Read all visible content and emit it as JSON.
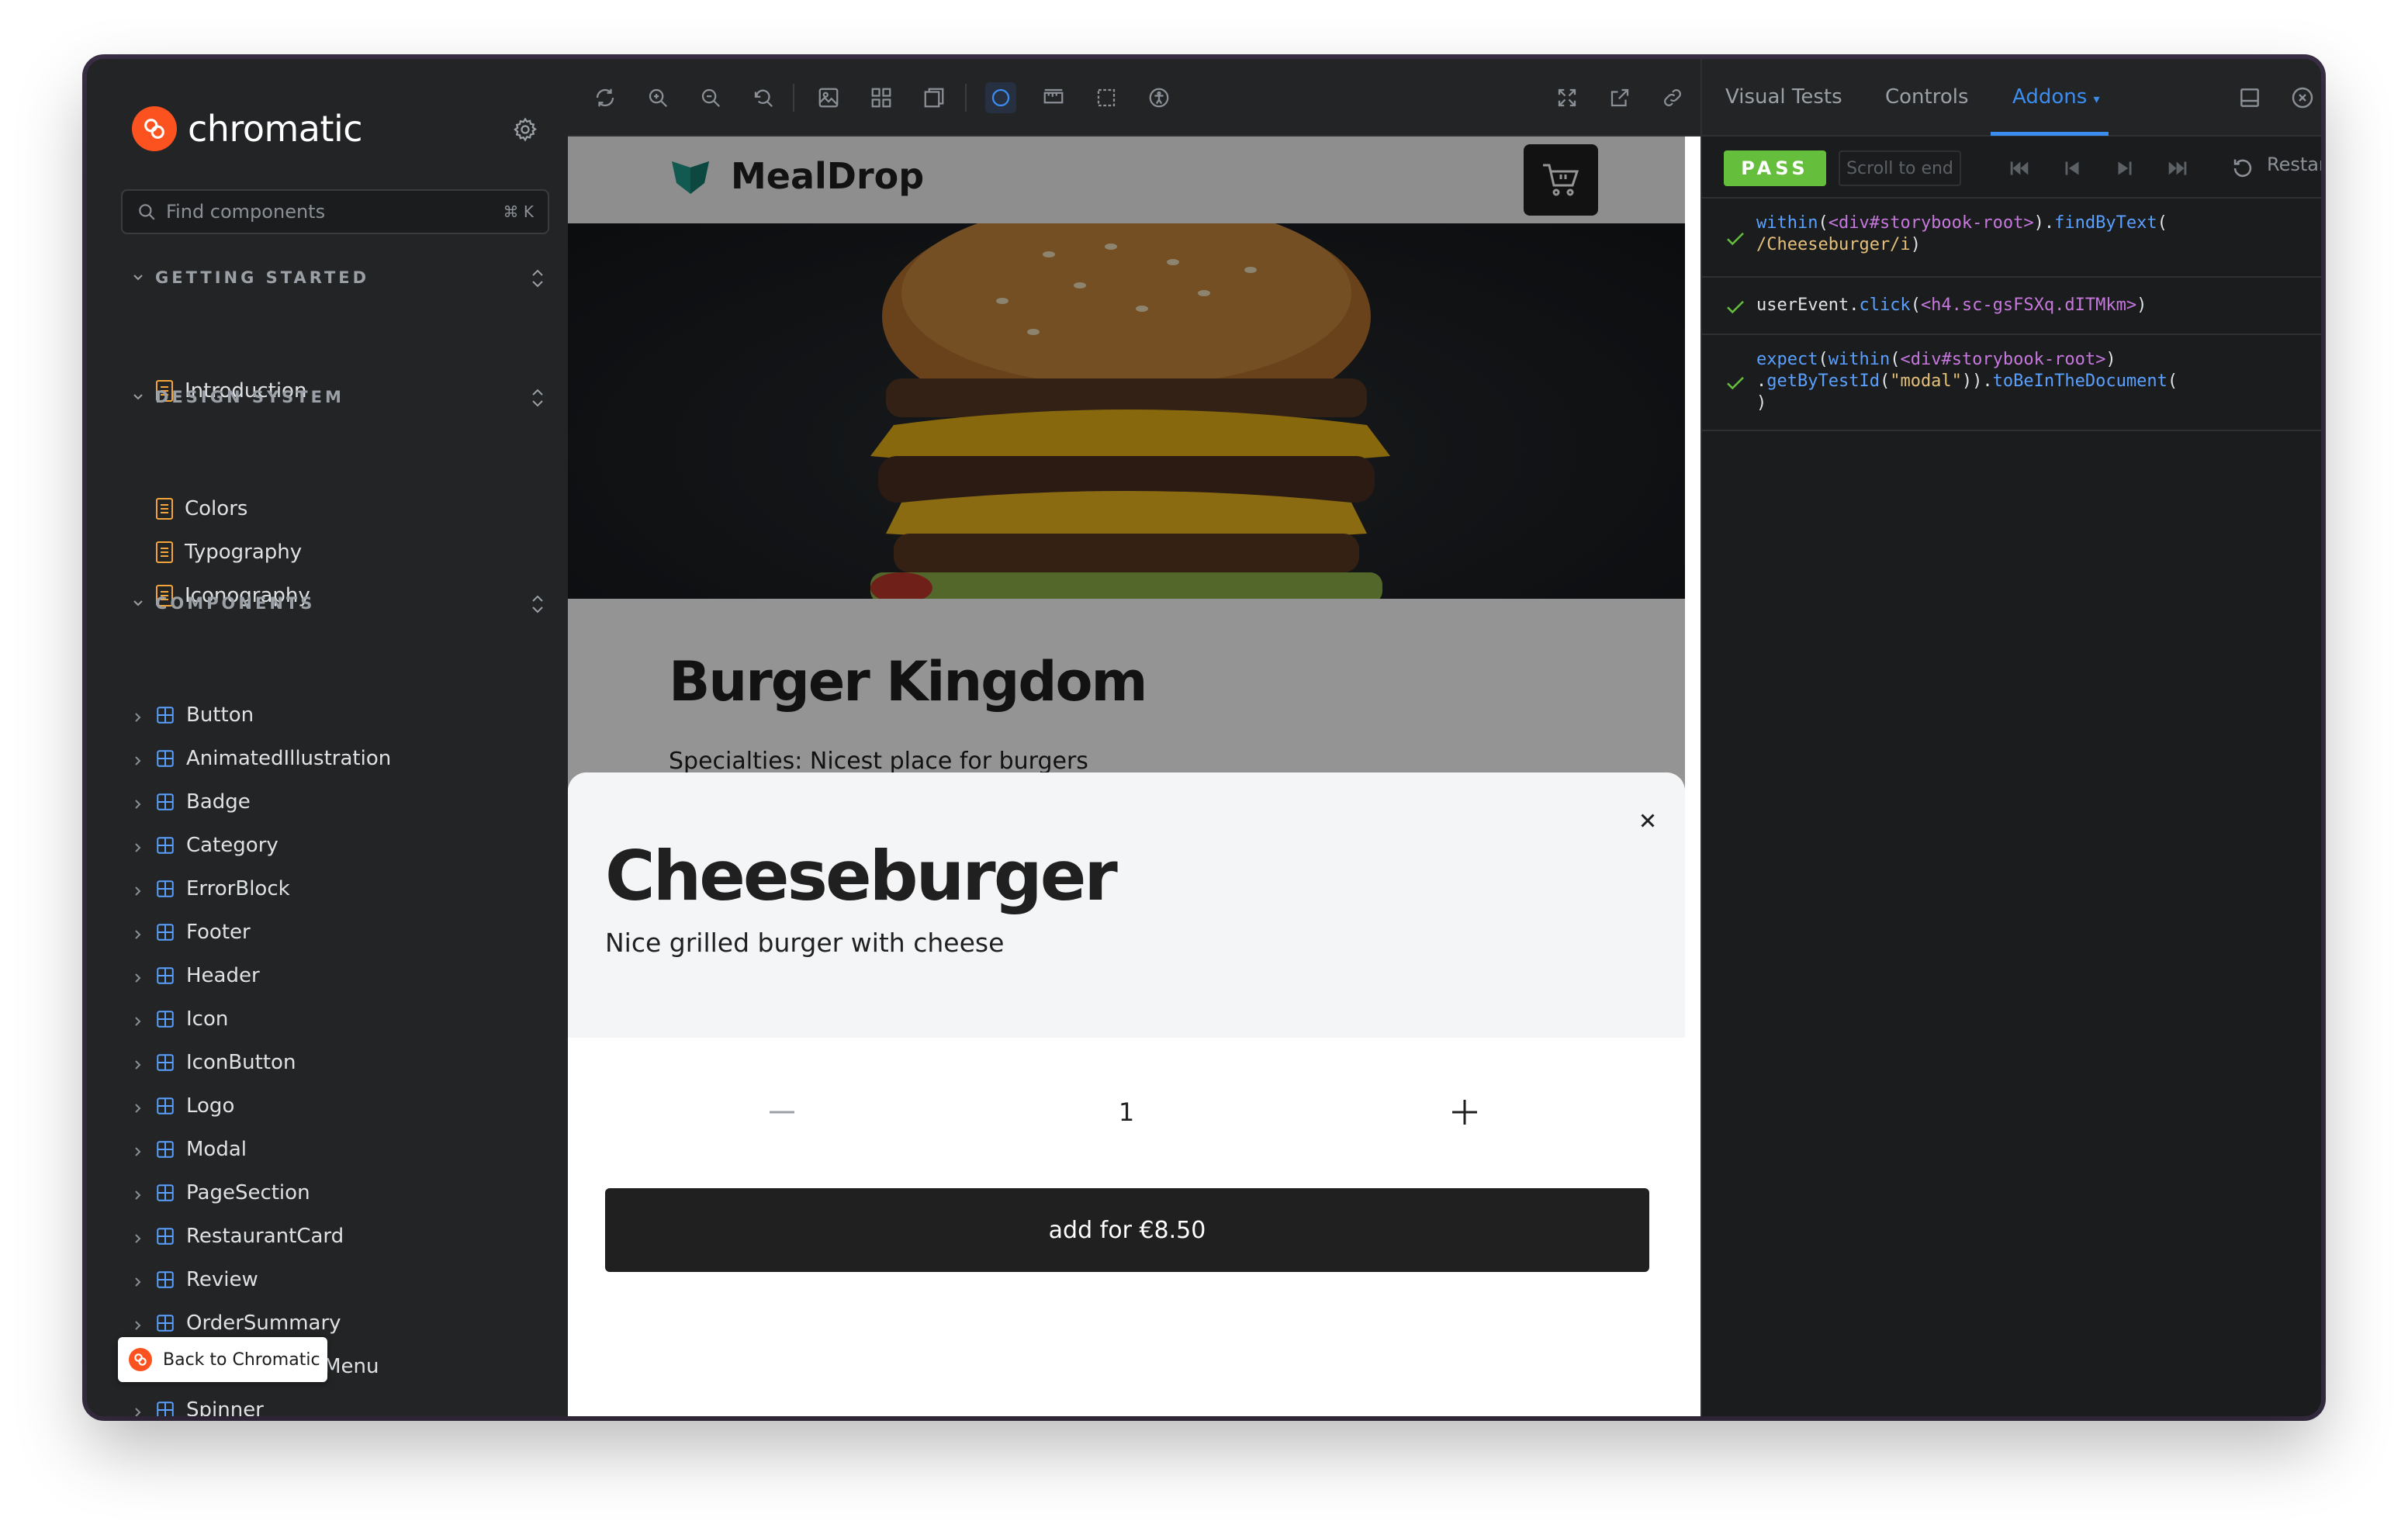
{
  "brand": {
    "name": "chromatic"
  },
  "sidebar": {
    "search_placeholder": "Find components",
    "search_shortcut": "⌘ K",
    "sections": [
      {
        "title": "GETTING STARTED",
        "items": [
          "Introduction"
        ]
      },
      {
        "title": "DESIGN SYSTEM",
        "items": [
          "Colors",
          "Typography",
          "Iconography"
        ]
      },
      {
        "title": "COMPONENTS",
        "items": [
          "Button",
          "AnimatedIllustration",
          "Badge",
          "Category",
          "ErrorBlock",
          "Footer",
          "Header",
          "Icon",
          "IconButton",
          "Logo",
          "Modal",
          "PageSection",
          "RestaurantCard",
          "Review",
          "OrderSummary",
          "ShoppingCartMenu",
          "Spinner"
        ]
      }
    ],
    "back_button": "Back to Chromatic"
  },
  "preview": {
    "site_name": "MealDrop",
    "restaurant_title": "Burger Kingdom",
    "restaurant_specialties": "Specialties: Nicest place for burgers",
    "modal": {
      "title": "Cheeseburger",
      "description": "Nice grilled burger with cheese",
      "quantity": "1",
      "add_button": "add for €8.50"
    }
  },
  "addons": {
    "tabs": [
      "Visual Tests",
      "Controls",
      "Addons"
    ],
    "active_tab": "Addons",
    "status": "PASS",
    "scroll_to_end": "Scroll to end",
    "restart": "Restart"
  },
  "colors": {
    "chromatic_orange": "#fc521f",
    "accent_blue": "#3b8df0",
    "pass_green": "#66bf3c",
    "sidebar_bg": "#222425"
  }
}
